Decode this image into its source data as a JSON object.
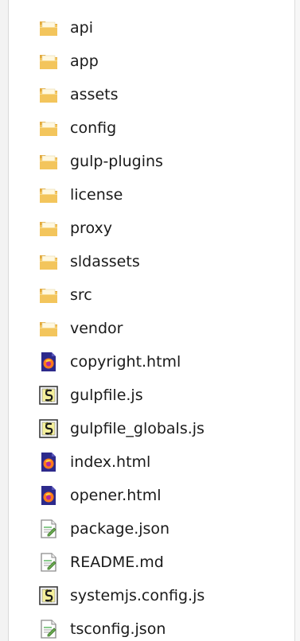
{
  "files": [
    {
      "name": "api",
      "type": "folder"
    },
    {
      "name": "app",
      "type": "folder"
    },
    {
      "name": "assets",
      "type": "folder"
    },
    {
      "name": "config",
      "type": "folder"
    },
    {
      "name": "gulp-plugins",
      "type": "folder"
    },
    {
      "name": "license",
      "type": "folder"
    },
    {
      "name": "proxy",
      "type": "folder"
    },
    {
      "name": "sldassets",
      "type": "folder"
    },
    {
      "name": "src",
      "type": "folder"
    },
    {
      "name": "vendor",
      "type": "folder"
    },
    {
      "name": "copyright.html",
      "type": "html"
    },
    {
      "name": "gulpfile.js",
      "type": "script"
    },
    {
      "name": "gulpfile_globals.js",
      "type": "script"
    },
    {
      "name": "index.html",
      "type": "html"
    },
    {
      "name": "opener.html",
      "type": "html"
    },
    {
      "name": "package.json",
      "type": "text"
    },
    {
      "name": "README.md",
      "type": "text"
    },
    {
      "name": "systemjs.config.js",
      "type": "script"
    },
    {
      "name": "tsconfig.json",
      "type": "text"
    }
  ],
  "icons": {
    "folder": "folder-icon",
    "html": "firefox-html-icon",
    "script": "script-file-icon",
    "text": "text-file-icon"
  },
  "colors": {
    "folder_body": "#f3c55c",
    "folder_tab": "#e3a93a",
    "html_frame": "#2d2a8c",
    "html_flame": "#ff7a1a",
    "script_frame": "#3a3a3a",
    "text_frame": "#8a8a8a"
  }
}
